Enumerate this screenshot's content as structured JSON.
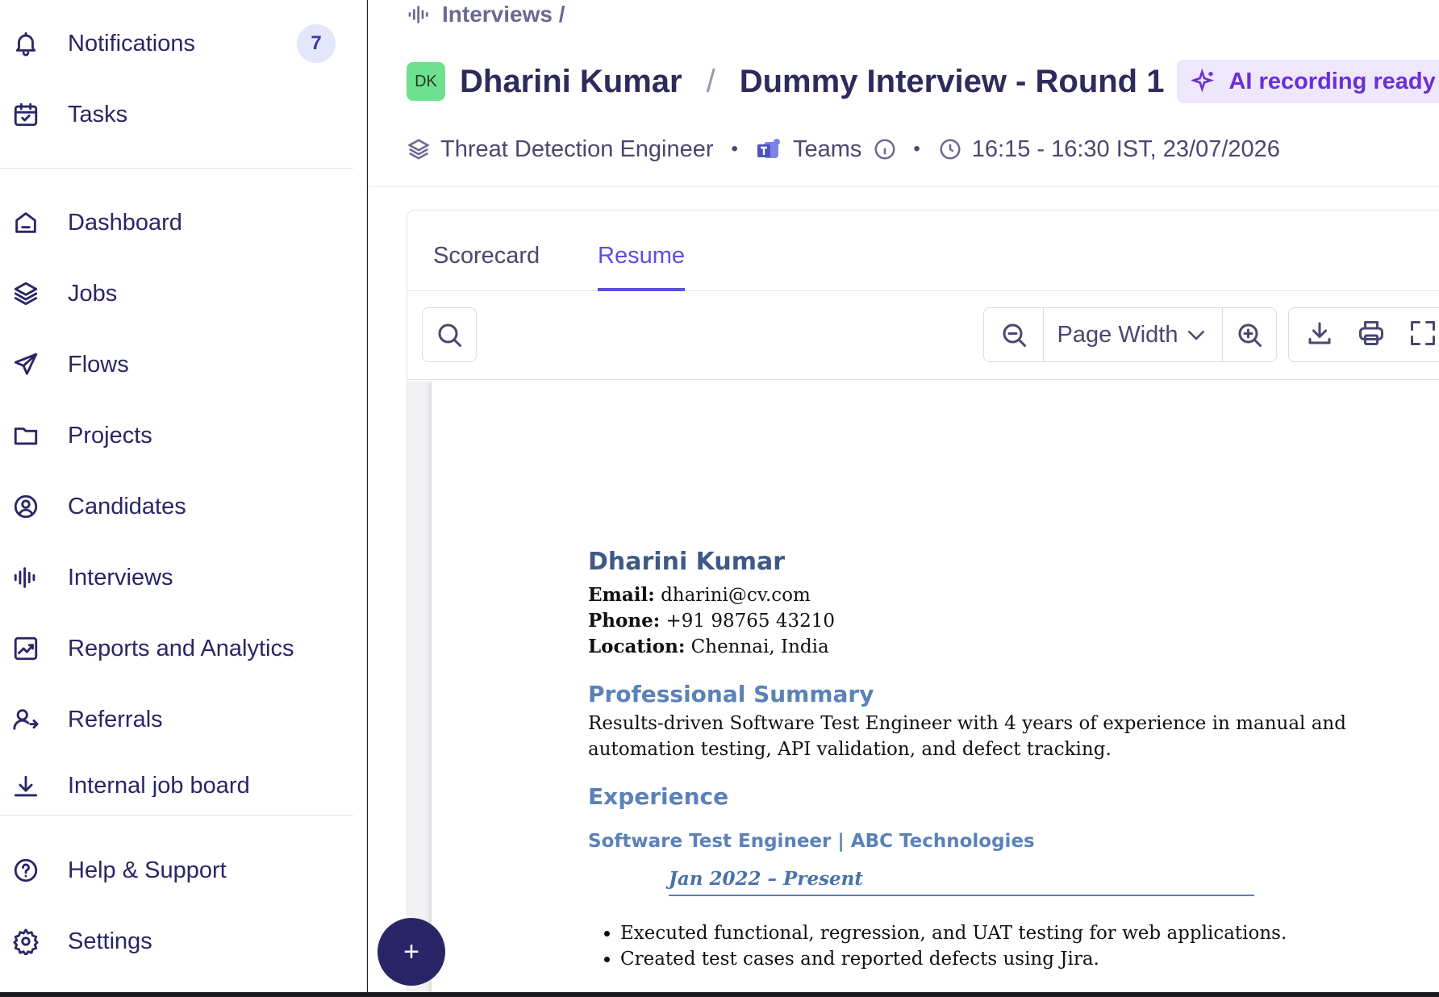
{
  "sidebar": {
    "notifications": {
      "label": "Notifications",
      "count": "7"
    },
    "tasks": {
      "label": "Tasks"
    },
    "items": [
      {
        "label": "Dashboard",
        "icon": "home-icon"
      },
      {
        "label": "Jobs",
        "icon": "layers-icon"
      },
      {
        "label": "Flows",
        "icon": "send-icon"
      },
      {
        "label": "Projects",
        "icon": "folder-icon"
      },
      {
        "label": "Candidates",
        "icon": "user-circle-icon"
      },
      {
        "label": "Interviews",
        "icon": "waveform-icon"
      },
      {
        "label": "Reports and Analytics",
        "icon": "chart-icon"
      },
      {
        "label": "Referrals",
        "icon": "users-icon"
      },
      {
        "label": "Internal job board",
        "icon": "download-icon"
      }
    ],
    "help": {
      "label": "Help & Support"
    },
    "settings": {
      "label": "Settings"
    },
    "fab_label": "+"
  },
  "header": {
    "breadcrumb": "Interviews /",
    "avatar_initials": "DK",
    "candidate_name": "Dharini Kumar",
    "separator": "/",
    "interview_title": "Dummy Interview - Round 1",
    "ai_status": "AI recording ready",
    "job": "Threat Detection Engineer",
    "platform": "Teams",
    "time": "16:15 - 16:30 IST, 23/07/2026",
    "dot": "•"
  },
  "tabs": [
    {
      "label": "Scorecard",
      "active": false
    },
    {
      "label": "Resume",
      "active": true
    }
  ],
  "viewer": {
    "zoom": "Page Width"
  },
  "resume": {
    "name": "Dharini Kumar",
    "email_label": "Email:",
    "email": "dharini@cv.com",
    "phone_label": "Phone:",
    "phone": "+91 98765 43210",
    "location_label": "Location:",
    "location": "Chennai, India",
    "summary_heading": "Professional Summary",
    "summary": "Results-driven Software Test Engineer with 4 years of experience in manual and automation testing, API validation, and defect tracking.",
    "experience_heading": "Experience",
    "role": "Software Test Engineer | ABC Technologies",
    "dates": "Jan 2022 – Present",
    "bullets": [
      "Executed functional, regression, and UAT testing for web applications.",
      "Created test cases and reported defects using Jira."
    ]
  },
  "colors": {
    "primary": "#2a2566",
    "accent": "#5a4fe0",
    "avatar": "#6ee08f",
    "ai_pill_bg": "#efe7fd",
    "resume_heading": "#5a82b8"
  }
}
